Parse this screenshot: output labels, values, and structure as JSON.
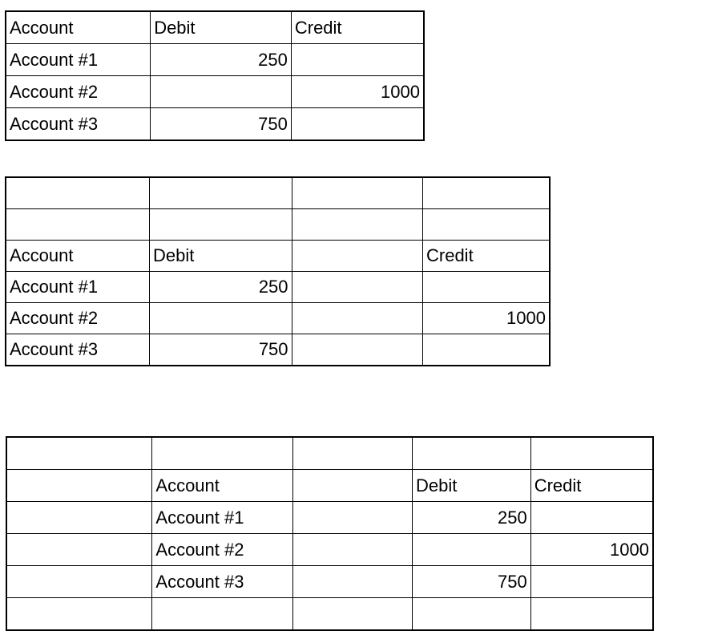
{
  "document": {
    "kind": "spreadsheet-tables",
    "background_color": "#ffffff",
    "text_color": "#000000",
    "grid_line_color": "#000000"
  },
  "labels": {
    "account": "Account",
    "debit": "Debit",
    "credit": "Credit",
    "account_1": "Account #1",
    "account_2": "Account #2",
    "account_3": "Account #3",
    "amount_250": "250",
    "amount_1000": "1000",
    "amount_750": "750",
    "blank": ""
  },
  "tables": [
    {
      "name": "table-1",
      "columns": 3,
      "rows": [
        [
          {
            "text": "Account",
            "align": "left"
          },
          {
            "text": "Debit",
            "align": "left"
          },
          {
            "text": "Credit",
            "align": "left"
          }
        ],
        [
          {
            "text": "Account #1",
            "align": "left"
          },
          {
            "text": "250",
            "align": "right"
          },
          {
            "text": "",
            "align": "left"
          }
        ],
        [
          {
            "text": "Account #2",
            "align": "left"
          },
          {
            "text": "",
            "align": "left"
          },
          {
            "text": "1000",
            "align": "right"
          }
        ],
        [
          {
            "text": "Account #3",
            "align": "left"
          },
          {
            "text": "750",
            "align": "right"
          },
          {
            "text": "",
            "align": "left"
          }
        ]
      ]
    },
    {
      "name": "table-2",
      "columns": 4,
      "rows": [
        [
          {
            "text": "",
            "align": "left"
          },
          {
            "text": "",
            "align": "left"
          },
          {
            "text": "",
            "align": "left"
          },
          {
            "text": "",
            "align": "left"
          }
        ],
        [
          {
            "text": "",
            "align": "left"
          },
          {
            "text": "",
            "align": "left"
          },
          {
            "text": "",
            "align": "left"
          },
          {
            "text": "",
            "align": "left"
          }
        ],
        [
          {
            "text": "Account",
            "align": "left"
          },
          {
            "text": "Debit",
            "align": "left"
          },
          {
            "text": "",
            "align": "left"
          },
          {
            "text": "Credit",
            "align": "left"
          }
        ],
        [
          {
            "text": "Account #1",
            "align": "left"
          },
          {
            "text": "250",
            "align": "right"
          },
          {
            "text": "",
            "align": "left"
          },
          {
            "text": "",
            "align": "left"
          }
        ],
        [
          {
            "text": "Account #2",
            "align": "left"
          },
          {
            "text": "",
            "align": "left"
          },
          {
            "text": "",
            "align": "left"
          },
          {
            "text": "1000",
            "align": "right"
          }
        ],
        [
          {
            "text": "Account #3",
            "align": "left"
          },
          {
            "text": "750",
            "align": "right"
          },
          {
            "text": "",
            "align": "left"
          },
          {
            "text": "",
            "align": "left"
          }
        ]
      ]
    },
    {
      "name": "table-3",
      "columns": 5,
      "clipped_at_bottom": true,
      "rows": [
        [
          {
            "text": "",
            "align": "left"
          },
          {
            "text": "",
            "align": "left"
          },
          {
            "text": "",
            "align": "left"
          },
          {
            "text": "",
            "align": "left"
          },
          {
            "text": "",
            "align": "left"
          }
        ],
        [
          {
            "text": "",
            "align": "left"
          },
          {
            "text": "Account",
            "align": "left"
          },
          {
            "text": "",
            "align": "left"
          },
          {
            "text": "Debit",
            "align": "left"
          },
          {
            "text": "Credit",
            "align": "left"
          }
        ],
        [
          {
            "text": "",
            "align": "left"
          },
          {
            "text": "Account #1",
            "align": "left"
          },
          {
            "text": "",
            "align": "left"
          },
          {
            "text": "250",
            "align": "right"
          },
          {
            "text": "",
            "align": "left"
          }
        ],
        [
          {
            "text": "",
            "align": "left"
          },
          {
            "text": "Account #2",
            "align": "left"
          },
          {
            "text": "",
            "align": "left"
          },
          {
            "text": "",
            "align": "left"
          },
          {
            "text": "1000",
            "align": "right"
          }
        ],
        [
          {
            "text": "",
            "align": "left"
          },
          {
            "text": "Account #3",
            "align": "left"
          },
          {
            "text": "",
            "align": "left"
          },
          {
            "text": "750",
            "align": "right"
          },
          {
            "text": "",
            "align": "left"
          }
        ],
        [
          {
            "text": "",
            "align": "left"
          },
          {
            "text": "",
            "align": "left"
          },
          {
            "text": "",
            "align": "left"
          },
          {
            "text": "",
            "align": "left"
          },
          {
            "text": "",
            "align": "left"
          }
        ]
      ]
    }
  ]
}
